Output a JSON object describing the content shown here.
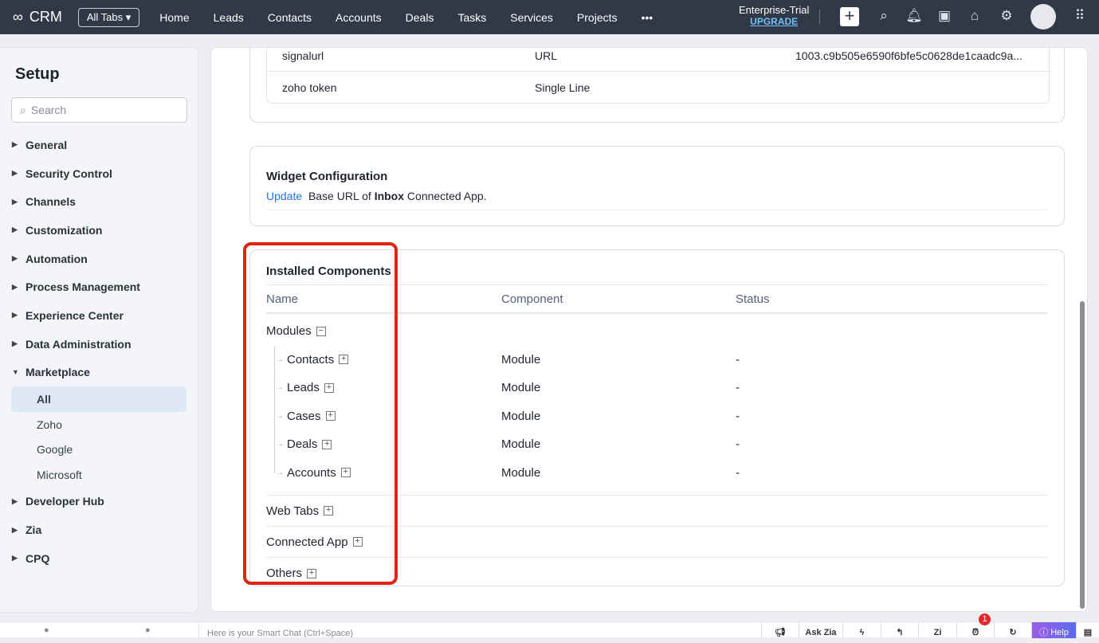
{
  "topbar": {
    "app": "CRM",
    "all_tabs": "All Tabs",
    "nav": [
      "Home",
      "Leads",
      "Contacts",
      "Accounts",
      "Deals",
      "Tasks",
      "Services",
      "Projects"
    ],
    "more": "•••",
    "plan": "Enterprise-Trial",
    "upgrade": "UPGRADE"
  },
  "sidebar": {
    "title": "Setup",
    "search_placeholder": "Search",
    "items": [
      "General",
      "Security Control",
      "Channels",
      "Customization",
      "Automation",
      "Process Management",
      "Experience Center",
      "Data Administration"
    ],
    "marketplace": "Marketplace",
    "sub": [
      "All",
      "Zoho",
      "Google",
      "Microsoft"
    ],
    "items2": [
      "Developer Hub",
      "Zia",
      "CPQ"
    ]
  },
  "fields": [
    {
      "name": "signalurl",
      "type": "URL",
      "value": "1003.c9b505e6590f6bfe5c0628de1caadc9a..."
    },
    {
      "name": "zoho token",
      "type": "Single Line",
      "value": ""
    }
  ],
  "widget": {
    "title": "Widget Configuration",
    "link": "Update",
    "text1": "Base URL of",
    "bold": "Inbox",
    "text2": "Connected App."
  },
  "components": {
    "title": "Installed Components",
    "headers": [
      "Name",
      "Component",
      "Status"
    ],
    "modules": "Modules",
    "rows": [
      {
        "name": "Contacts",
        "component": "Module",
        "status": "-"
      },
      {
        "name": "Leads",
        "component": "Module",
        "status": "-"
      },
      {
        "name": "Cases",
        "component": "Module",
        "status": "-"
      },
      {
        "name": "Deals",
        "component": "Module",
        "status": "-"
      },
      {
        "name": "Accounts",
        "component": "Module",
        "status": "-"
      }
    ],
    "groups": [
      "Web Tabs",
      "Connected App",
      "Others"
    ]
  },
  "bottom": {
    "chat_placeholder": "Here is your Smart Chat (Ctrl+Space)",
    "ask_zia": "Ask Zia",
    "help": "Help",
    "badge": "1"
  }
}
